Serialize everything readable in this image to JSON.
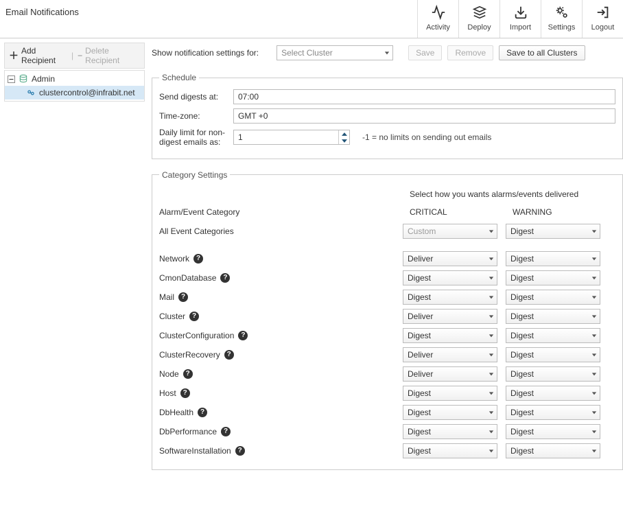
{
  "header": {
    "title": "Email Notifications",
    "actions": [
      {
        "key": "activity",
        "label": "Activity",
        "icon": "activity-icon"
      },
      {
        "key": "deploy",
        "label": "Deploy",
        "icon": "stack-icon"
      },
      {
        "key": "import",
        "label": "Import",
        "icon": "import-icon"
      },
      {
        "key": "settings",
        "label": "Settings",
        "icon": "gears-icon"
      },
      {
        "key": "logout",
        "label": "Logout",
        "icon": "logout-icon"
      }
    ]
  },
  "sidebar": {
    "add_label": "Add Recipient",
    "delete_label": "Delete Recipient",
    "tree": {
      "root_label": "Admin",
      "child_label": "clustercontrol@infrabit.net"
    }
  },
  "filter": {
    "label": "Show notification settings for:",
    "cluster_placeholder": "Select Cluster",
    "save": "Save",
    "remove": "Remove",
    "save_all": "Save to all Clusters"
  },
  "schedule": {
    "legend": "Schedule",
    "send_label": "Send digests at:",
    "send_value": "07:00",
    "tz_label": "Time-zone:",
    "tz_value": "GMT +0",
    "limit_label": "Daily limit for non-digest emails as:",
    "limit_value": "1",
    "limit_hint": "-1 = no limits on sending out emails"
  },
  "categories": {
    "legend": "Category Settings",
    "instruction": "Select how you wants alarms/events delivered",
    "col_category": "Alarm/Event Category",
    "col_critical": "CRITICAL",
    "col_warning": "WARNING",
    "all_label": "All Event Categories",
    "all_critical": "Custom",
    "all_warning": "Digest",
    "rows": [
      {
        "name": "Network",
        "critical": "Deliver",
        "warning": "Digest"
      },
      {
        "name": "CmonDatabase",
        "critical": "Digest",
        "warning": "Digest"
      },
      {
        "name": "Mail",
        "critical": "Digest",
        "warning": "Digest"
      },
      {
        "name": "Cluster",
        "critical": "Deliver",
        "warning": "Digest"
      },
      {
        "name": "ClusterConfiguration",
        "critical": "Digest",
        "warning": "Digest"
      },
      {
        "name": "ClusterRecovery",
        "critical": "Deliver",
        "warning": "Digest"
      },
      {
        "name": "Node",
        "critical": "Deliver",
        "warning": "Digest"
      },
      {
        "name": "Host",
        "critical": "Digest",
        "warning": "Digest"
      },
      {
        "name": "DbHealth",
        "critical": "Digest",
        "warning": "Digest"
      },
      {
        "name": "DbPerformance",
        "critical": "Digest",
        "warning": "Digest"
      },
      {
        "name": "SoftwareInstallation",
        "critical": "Digest",
        "warning": "Digest"
      }
    ]
  }
}
